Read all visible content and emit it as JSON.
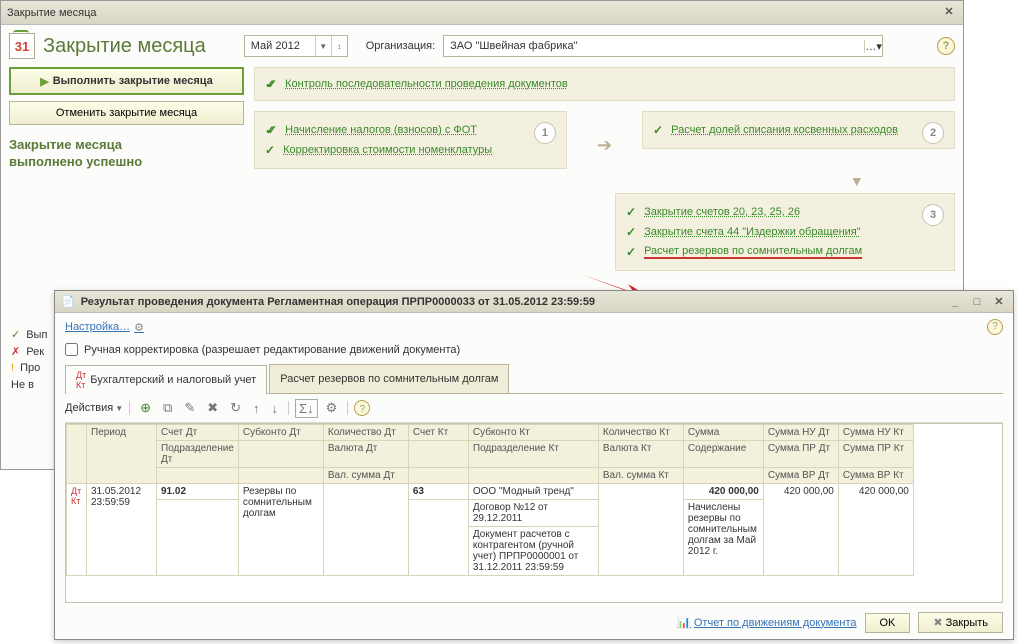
{
  "mainWindow": {
    "title": "Закрытие месяца",
    "heading": "Закрытие месяца",
    "calendarNum": "31",
    "period": "Май 2012",
    "orgLabel": "Организация:",
    "org": "ЗАО \"Швейная фабрика\"",
    "primaryBtn": "Выполнить закрытие месяца",
    "secondaryBtn": "Отменить закрытие месяца",
    "statusLine1": "Закрытие месяца",
    "statusLine2": "выполнено успешно"
  },
  "ops": {
    "control": "Контроль последовательности проведения документов",
    "block1": {
      "num": "1",
      "item1": "Начисление налогов (взносов) с ФОТ",
      "item2": "Корректировка стоимости номенклатуры"
    },
    "block2": {
      "num": "2",
      "item1": "Расчет долей списания косвенных расходов"
    },
    "block3": {
      "num": "3",
      "item1": "Закрытие счетов 20, 23, 25, 26",
      "item2": "Закрытие счета 44 \"Издержки обращения\"",
      "item3": "Расчет резервов по сомнительным долгам"
    }
  },
  "partial": {
    "r1": "Вып",
    "r2": "Рек",
    "r3": "Про",
    "r4": "Не в"
  },
  "subWindow": {
    "title": "Результат проведения документа Регламентная операция ПРПР0000033 от 31.05.2012 23:59:59",
    "settings": "Настройка…",
    "manualEdit": "Ручная корректировка (разрешает редактирование движений документа)",
    "tab1": "Бухгалтерский и налоговый учет",
    "tab2": "Расчет резервов по сомнительным долгам",
    "actions": "Действия",
    "headers": {
      "period": "Период",
      "accDt": "Счет Дт",
      "subDt": "Субконто Дт",
      "qtyDt": "Количество Дт",
      "accKt": "Счет Кт",
      "subKt": "Субконто Кт",
      "qtyKt": "Количество Кт",
      "sum": "Сумма",
      "sumNUDt": "Сумма НУ Дт",
      "sumNUKt": "Сумма НУ Кт",
      "podrDt": "Подразделение Дт",
      "valDt": "Валюта Дт",
      "podrKt": "Подразделение Кт",
      "valKt": "Валюта Кт",
      "content": "Содержание",
      "sumPRDt": "Сумма ПР Дт",
      "sumPRKt": "Сумма ПР Кт",
      "valSumDt": "Вал. сумма Дт",
      "valSumKt": "Вал. сумма Кт",
      "sumVRDt": "Сумма ВР Дт",
      "sumVRKt": "Сумма ВР Кт"
    },
    "row": {
      "date": "31.05.2012 23:59:59",
      "accDt": "91.02",
      "subDt": "Резервы по сомнительным долгам",
      "accKt": "63",
      "subKt1": "ООО \"Модный тренд\"",
      "subKt2": "Договор №12 от 29.12.2011",
      "subKt3": "Документ расчетов с контрагентом (ручной учет) ПРПР0000001 от 31.12.2011 23:59:59",
      "sum": "420 000,00",
      "content": "Начислены резервы по сомнительным долгам за Май 2012 г.",
      "sumNUDt": "420 000,00",
      "sumNUKt": "420 000,00"
    },
    "footerReport": "Отчет по движениям документа",
    "okBtn": "OK",
    "closeBtn": "Закрыть"
  }
}
